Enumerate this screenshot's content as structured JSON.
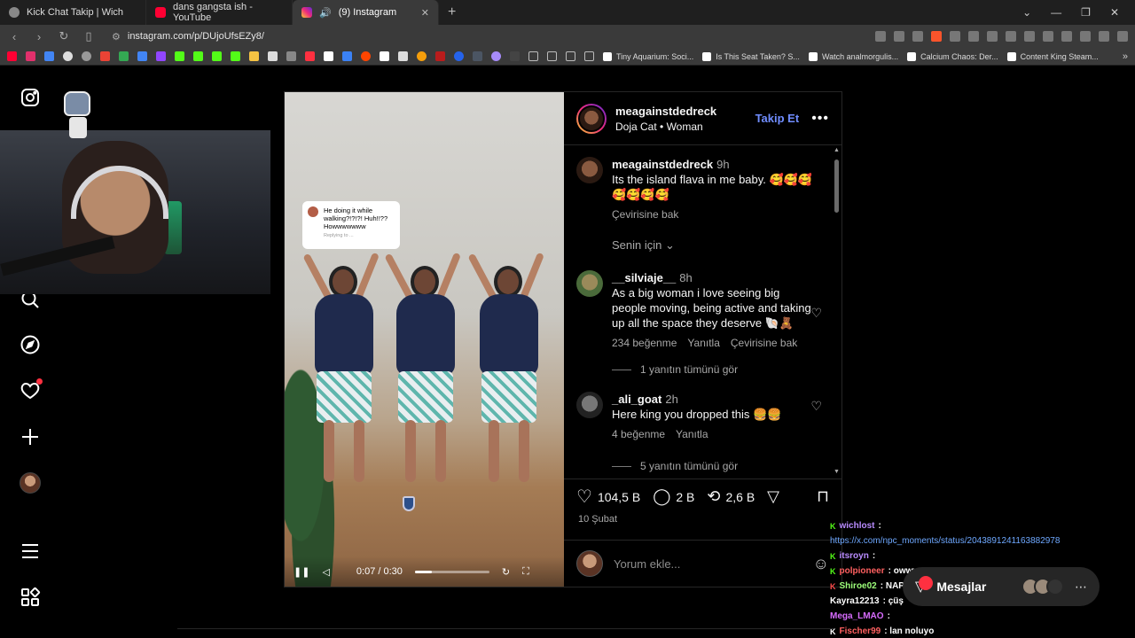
{
  "browser": {
    "tabs": [
      {
        "title": "Kick Chat Takip | Wich",
        "favicon": "globe-icon"
      },
      {
        "title": "dans gangsta ish - YouTube",
        "favicon": "youtube-icon"
      },
      {
        "title": "(9) Instagram",
        "favicon": "instagram-icon"
      }
    ],
    "url": "instagram.com/p/DUjoUfsEZy8/",
    "bookmarks": [
      "Tiny Aquarium: Soci...",
      "Is This Seat Taken? S...",
      "Watch analmorgulis...",
      "Calcium Chaos: Der...",
      "Content King Steam..."
    ],
    "accent": "#3a3a3a"
  },
  "post": {
    "author": "meagainstdedreck",
    "audio": "Doja Cat",
    "audio_track": "Woman",
    "follow_label": "Takip Et",
    "video": {
      "quote_text": "He doing it while walking?!?!?! Huh!!?? Howwwwwww",
      "quote_sub": "Replying to ...",
      "time": "0:07 / 0:30",
      "progress": 0.233
    },
    "comments": [
      {
        "user": "meagainstdedreck",
        "time": "9h",
        "text": "Its the island flava in me baby. 🥰🥰🥰🥰🥰🥰🥰",
        "translate": "Çevirisine bak"
      },
      {
        "user": "__silviaje__",
        "time": "8h",
        "text": "As a big woman i love seeing big people moving, being active and taking up all the space they deserve 🐚🧸",
        "likes": "234 beğenme",
        "reply": "Yanıtla",
        "translate": "Çevirisine bak",
        "replies": "1 yanıtın tümünü gör"
      },
      {
        "user": "_ali_goat",
        "time": "2h",
        "text": "Here king you dropped this 🍔🍔",
        "likes": "4 beğenme",
        "reply": "Yanıtla",
        "replies": "5 yanıtın tümünü gör"
      }
    ],
    "for_you": "Senin için",
    "likes": "104,5 B",
    "comments_count": "2 B",
    "reposts": "2,6 B",
    "date": "10 Şubat",
    "add_comment_placeholder": "Yorum ekle..."
  },
  "chat": {
    "lines": [
      {
        "user": "wichlost",
        "text": ":",
        "color": "#b98cff"
      },
      {
        "user": "",
        "text": "https://x.com/npc_moments/status/2043891241163882978",
        "color": "#6ea8ff"
      },
      {
        "user": "itsroyn",
        "text": ":",
        "color": "#b98cff"
      },
      {
        "user": "polpioneer",
        "text": ": owwwwwwww",
        "color": "#ff6060"
      },
      {
        "user": "Shiroe02",
        "text": ": NAPIYON AMK",
        "color": "#9dff7a"
      },
      {
        "user": "Kayra12213",
        "text": ": çüş",
        "color": "#ffffff"
      },
      {
        "user": "Mega_LMAO",
        "text": ":",
        "color": "#d86cff"
      },
      {
        "user": "Fischer99",
        "text": ": lan noluyo",
        "color": "#ff6060"
      }
    ]
  },
  "messages": {
    "label": "Mesajlar"
  }
}
